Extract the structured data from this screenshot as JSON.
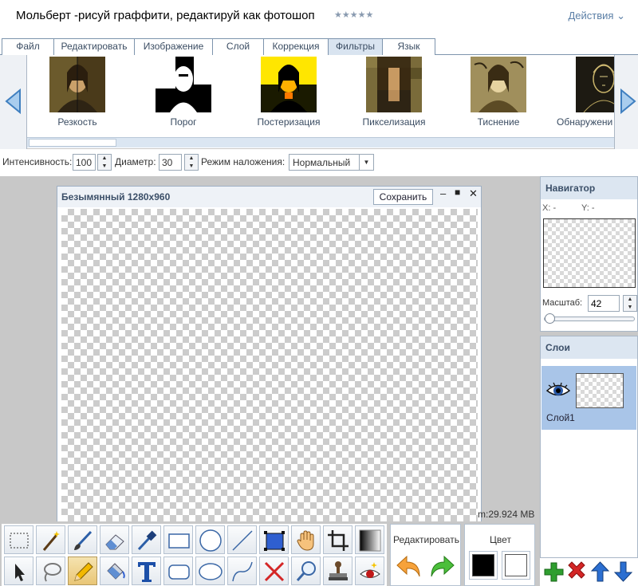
{
  "app": {
    "title": "Мольберт -рисуй граффити, редактируй как фотошоп",
    "stars": "★★★★★",
    "actions_label": "Действия"
  },
  "menu": {
    "items": [
      "Файл",
      "Редактировать",
      "Изображение",
      "Слой",
      "Коррекция",
      "Фильтры",
      "Язык"
    ],
    "active": "Фильтры"
  },
  "filters": {
    "items": [
      {
        "label": "Резкость"
      },
      {
        "label": "Порог"
      },
      {
        "label": "Постеризация"
      },
      {
        "label": "Пикселизация"
      },
      {
        "label": "Тиснение"
      },
      {
        "label": "Обнаружени"
      }
    ]
  },
  "options": {
    "intensity_label": "Интенсивность:",
    "intensity_value": "100",
    "diameter_label": "Диаметр:",
    "diameter_value": "30",
    "blend_label": "Режим наложения:",
    "blend_value": "Нормальный"
  },
  "document": {
    "title": "Безымянный 1280x960",
    "save_label": "Сохранить",
    "memory": "m:29.924 MB"
  },
  "navigator": {
    "title": "Навигатор",
    "x_label": "X: -",
    "y_label": "Y: -",
    "zoom_label": "Масштаб:",
    "zoom_value": "42",
    "zoom_slider_fraction": 0.0
  },
  "layers": {
    "title": "Слои",
    "items": [
      {
        "name": "Слой1"
      }
    ]
  },
  "edit_panel": {
    "label": "Редактировать"
  },
  "color_panel": {
    "label": "Цвет",
    "primary": "#000000",
    "secondary": "#ffffff"
  },
  "colors": {
    "accent": "#5b7fa6",
    "panel_header": "#dce6f1",
    "selection": "#a9c5e8"
  }
}
